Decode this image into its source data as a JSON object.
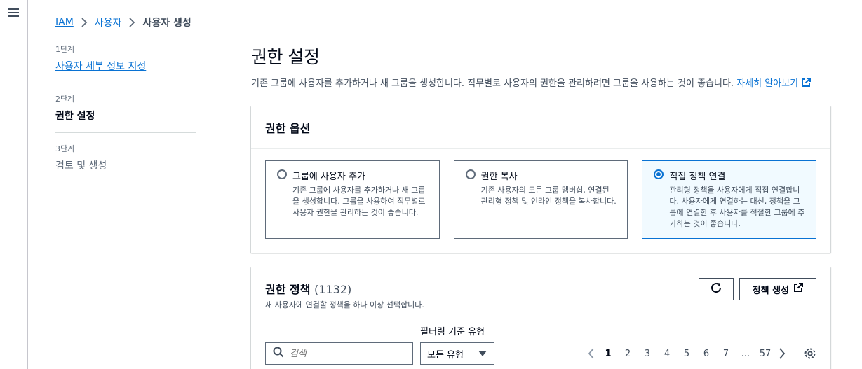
{
  "breadcrumb": {
    "root": "IAM",
    "users": "사용자",
    "current": "사용자 생성"
  },
  "steps": [
    {
      "num": "1단계",
      "label": "사용자 세부 정보 지정"
    },
    {
      "num": "2단계",
      "label": "권한 설정"
    },
    {
      "num": "3단계",
      "label": "검토 및 생성"
    }
  ],
  "page": {
    "title": "권한 설정",
    "desc": "기존 그룹에 사용자를 추가하거나 새 그룹을 생성합니다. 직무별로 사용자의 권한을 관리하려면 그룹을 사용하는 것이 좋습니다.",
    "learn_more": "자세히 알아보기"
  },
  "options_card": {
    "title": "권한 옵션",
    "options": [
      {
        "title": "그룹에 사용자 추가",
        "desc": "기존 그룹에 사용자를 추가하거나 새 그룹을 생성합니다. 그룹을 사용하여 직무별로 사용자 권한을 관리하는 것이 좋습니다."
      },
      {
        "title": "권한 복사",
        "desc": "기존 사용자의 모든 그룹 멤버십, 연결된 관리형 정책 및 인라인 정책을 복사합니다."
      },
      {
        "title": "직접 정책 연결",
        "desc": "관리형 정책을 사용자에게 직접 연결합니다. 사용자에게 연결하는 대신, 정책을 그룹에 연결한 후 사용자를 적절한 그룹에 추가하는 것이 좋습니다."
      }
    ],
    "selected_index": 2
  },
  "policies": {
    "title": "권한 정책",
    "count": "(1132)",
    "subtitle": "새 사용자에 연결할 정책을 하나 이상 선택합니다.",
    "create_label": "정책 생성",
    "search_placeholder": "검색",
    "filter_label": "필터링 기준 유형",
    "filter_value": "모든 유형",
    "pages": [
      "1",
      "2",
      "3",
      "4",
      "5",
      "6",
      "7",
      "...",
      "57"
    ],
    "current_page": "1"
  },
  "colors": {
    "accent": "#0972d3",
    "selected_bg": "#f1faff",
    "text": "#000716"
  }
}
